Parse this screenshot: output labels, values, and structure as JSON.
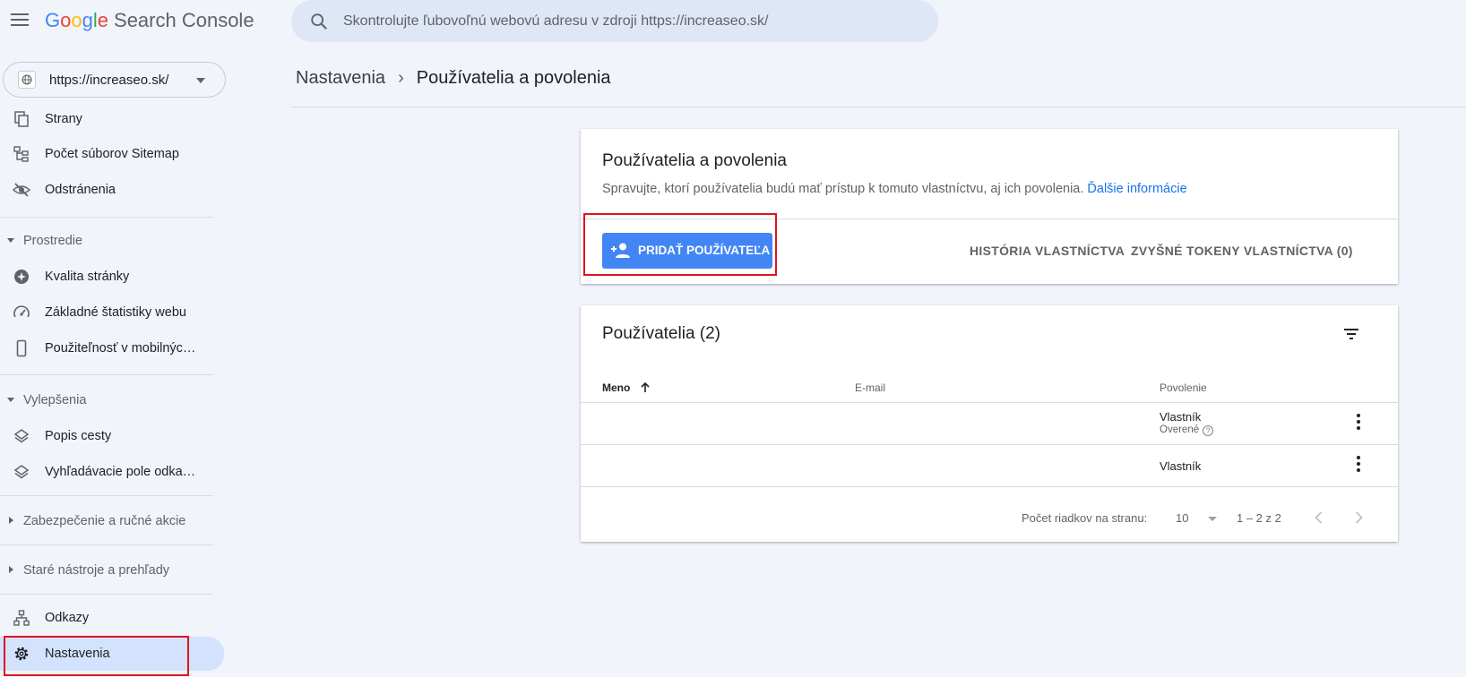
{
  "app": {
    "logo_letters": [
      "G",
      "o",
      "o",
      "g",
      "l",
      "e"
    ],
    "product": "Search Console"
  },
  "search": {
    "placeholder": "Skontrolujte ľubovoľnú webovú adresu v zdroji https://increaseo.sk/"
  },
  "property": {
    "url": "https://increaseo.sk/"
  },
  "sidebar": {
    "items_top": [
      {
        "label": "Strany",
        "icon": "pages-icon"
      },
      {
        "label": "Počet súborov Sitemap",
        "icon": "sitemap-icon"
      },
      {
        "label": "Odstránenia",
        "icon": "removals-icon"
      }
    ],
    "section_experience": "Prostredie",
    "items_experience": [
      {
        "label": "Kvalita stránky",
        "icon": "page-experience-icon"
      },
      {
        "label": "Základné štatistiky webu",
        "icon": "speedometer-icon"
      },
      {
        "label": "Použiteľnosť v mobilnýc…",
        "icon": "mobile-icon"
      }
    ],
    "section_enhancements": "Vylepšenia",
    "items_enhancements": [
      {
        "label": "Popis cesty",
        "icon": "layers-icon"
      },
      {
        "label": "Vyhľadávacie pole odka…",
        "icon": "layers-icon"
      }
    ],
    "section_security": "Zabezpečenie a ručné akcie",
    "section_legacy": "Staré nástroje a prehľady",
    "items_bottom": [
      {
        "label": "Odkazy",
        "icon": "links-icon"
      },
      {
        "label": "Nastavenia",
        "icon": "gear-icon"
      }
    ]
  },
  "breadcrumb": {
    "parent": "Nastavenia",
    "separator": "›",
    "current": "Používatelia a povolenia"
  },
  "permissions_card": {
    "title": "Používatelia a povolenia",
    "description": "Spravujte, ktorí používatelia budú mať prístup k tomuto vlastníctvu, aj ich povolenia.",
    "learn_more": "Ďalšie informácie",
    "add_user_label": "PRIDAŤ POUŽÍVATEĽA",
    "history_label": "HISTÓRIA VLASTNÍCTVA",
    "tokens_label": "ZVYŠNÉ TOKENY VLASTNÍCTVA (0)"
  },
  "users_table": {
    "title": "Používatelia (2)",
    "columns": {
      "name": "Meno",
      "email": "E-mail",
      "permission": "Povolenie"
    },
    "rows": [
      {
        "name": "",
        "email": "",
        "permission": "Vlastník",
        "status": "Overené"
      },
      {
        "name": "",
        "email": "",
        "permission": "Vlastník",
        "status": ""
      }
    ],
    "rows_per_page_label": "Počet riadkov na stranu:",
    "rows_per_page_value": "10",
    "range_text": "1 – 2 z 2"
  },
  "colors": {
    "accent": "#4285f4",
    "highlight": "#e0131b",
    "active_nav": "#d3e3fd"
  }
}
